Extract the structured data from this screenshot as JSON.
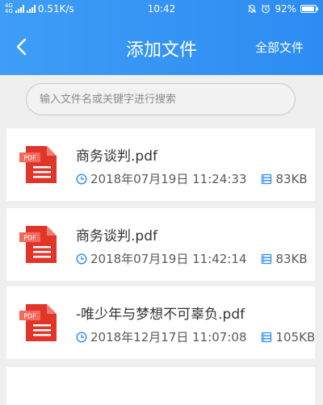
{
  "status_bar": {
    "network_top": "4G",
    "network_bottom": "4G",
    "speed": "0.51K/s",
    "time": "10:42",
    "battery": "92%",
    "battery_level": 0.92
  },
  "nav": {
    "title": "添加文件",
    "all_files_label": "全部文件"
  },
  "search": {
    "placeholder": "输入文件名或关键字进行搜索"
  },
  "files": [
    {
      "name": "商务谈判.pdf",
      "datetime": "2018年07月19日 11:24:33",
      "size": "83KB",
      "icon_label": "PDF"
    },
    {
      "name": "商务谈判.pdf",
      "datetime": "2018年07月19日 11:42:14",
      "size": "83KB",
      "icon_label": "PDF"
    },
    {
      "name": "-唯少年与梦想不可辜负.pdf",
      "datetime": "2018年12月17日 11:07:08",
      "size": "105KB",
      "icon_label": "PDF"
    }
  ],
  "colors": {
    "header": "#3e9df6",
    "pdf_red": "#e2352a",
    "meta_icon_blue": "#2d8cf1"
  }
}
